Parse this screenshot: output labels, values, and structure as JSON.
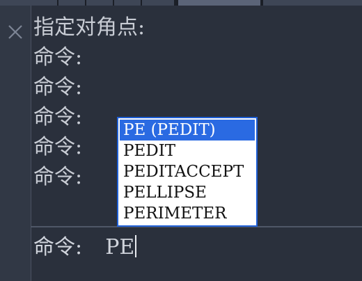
{
  "history": [
    {
      "text": "指定对角点:"
    },
    {
      "text": "命令:"
    },
    {
      "text": "命令:"
    },
    {
      "text": "命令:"
    },
    {
      "text": "命令:"
    },
    {
      "text": "命令:"
    }
  ],
  "prompt": {
    "label": "命令:",
    "input_value": "PE"
  },
  "autocomplete": {
    "items": [
      {
        "label": "PE (PEDIT)",
        "selected": true
      },
      {
        "label": "PEDIT",
        "selected": false
      },
      {
        "label": "PEDITACCEPT",
        "selected": false
      },
      {
        "label": "PELLIPSE",
        "selected": false
      },
      {
        "label": "PERIMETER",
        "selected": false
      }
    ]
  },
  "icons": {
    "close": "close-icon"
  },
  "colors": {
    "background": "#2a303c",
    "text": "#c8ccd4",
    "selection": "#2a6ae2",
    "popup_border": "#1f5fd6"
  }
}
